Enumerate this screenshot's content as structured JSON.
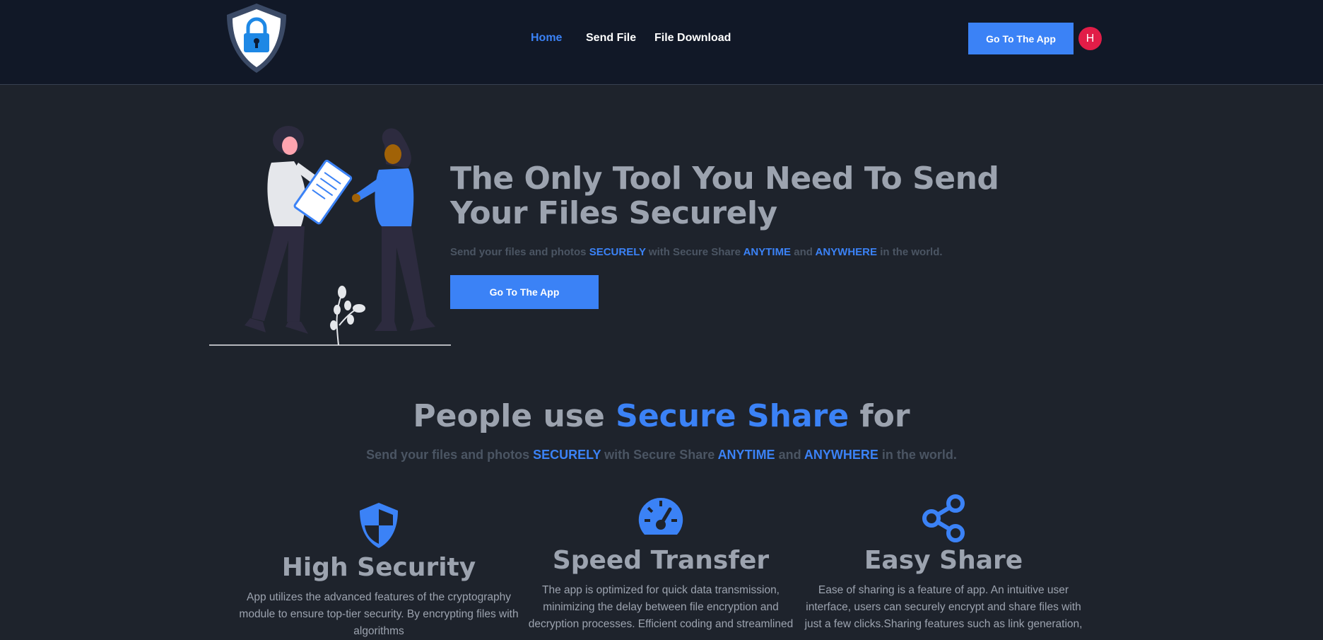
{
  "nav": {
    "links": [
      "Home",
      "Send File",
      "File Download"
    ],
    "cta": "Go To The App",
    "avatar_initial": "H"
  },
  "hero": {
    "title": "The Only Tool You Need To Send Your Files Securely",
    "sub": {
      "p1": "Send your files and photos ",
      "h1": "SECURELY",
      "p2": " with Secure Share ",
      "h2": "ANYTIME",
      "p3": " and ",
      "h3": "ANYWHERE",
      "p4": " in the world."
    },
    "cta": "Go To The App"
  },
  "section": {
    "title_pre": "People use ",
    "title_brand": "Secure Share",
    "title_post": " for",
    "sub": {
      "p1": "Send your files and photos ",
      "h1": "SECURELY",
      "p2": " with Secure Share ",
      "h2": "ANYTIME",
      "p3": " and ",
      "h3": "ANYWHERE",
      "p4": " in the world."
    }
  },
  "features": [
    {
      "icon": "shield-icon",
      "title": "High Security",
      "text": "App utilizes the advanced features of the cryptography module to ensure top-tier security. By encrypting files with algorithms"
    },
    {
      "icon": "speedometer-icon",
      "title": "Speed Transfer",
      "text": "The app is optimized for quick data transmission, minimizing the delay between file encryption and decryption processes. Efficient coding and streamlined"
    },
    {
      "icon": "share-icon",
      "title": "Easy Share",
      "text": "Ease of sharing is a feature of app. An intuitive user interface, users can securely encrypt and share files with just a few clicks.Sharing features such as link generation,"
    }
  ],
  "colors": {
    "accent": "#3b82f6",
    "nav_bg": "#111827",
    "page_bg": "#1e232c",
    "avatar": "#e11d48"
  }
}
